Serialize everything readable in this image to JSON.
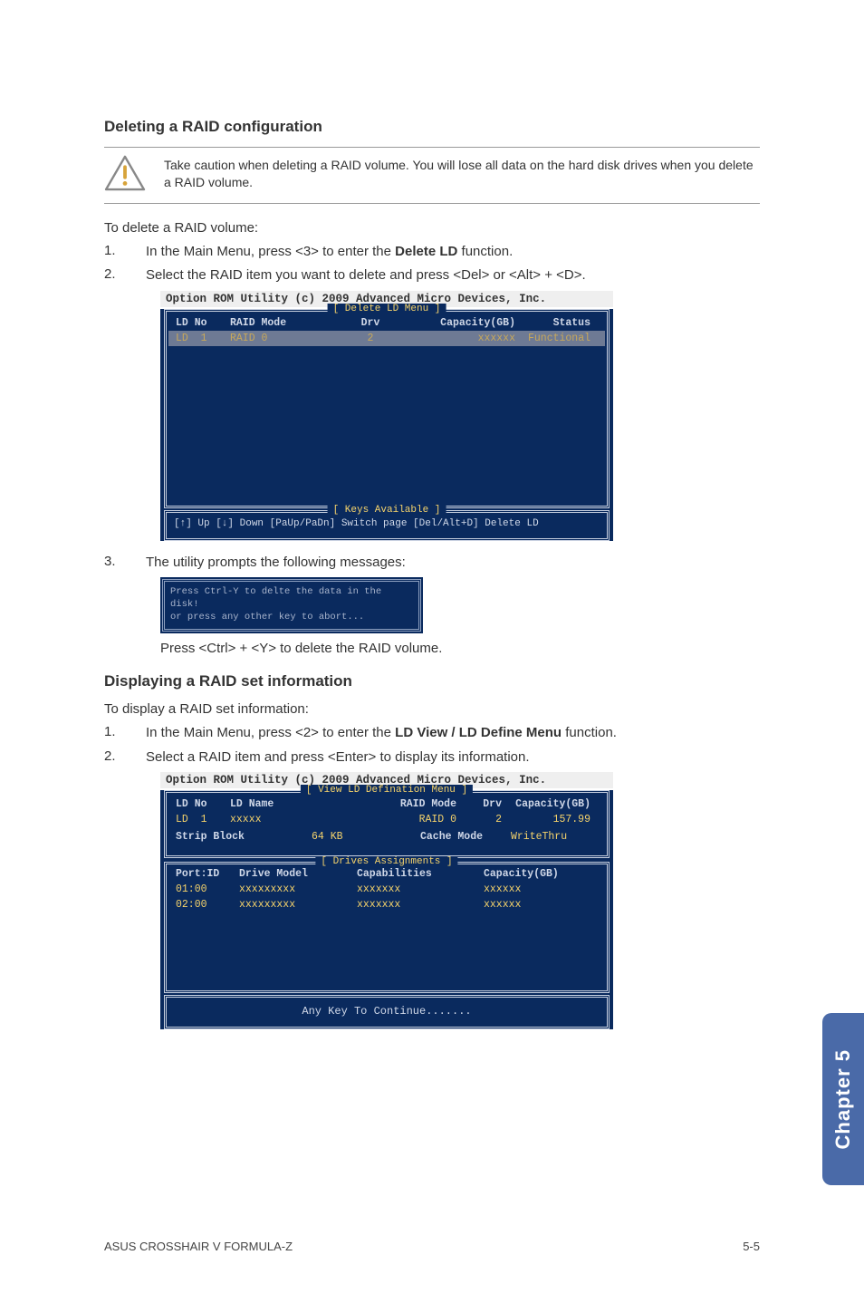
{
  "section1": {
    "heading": "Deleting a RAID configuration",
    "caution": "Take caution when deleting a RAID volume. You will lose all data on the hard disk drives when you delete a RAID volume.",
    "intro": "To delete a RAID volume:",
    "step1_pre": "In the Main Menu, press <3> to enter the ",
    "step1_strong": "Delete LD",
    "step1_post": " function.",
    "step2": "Select the RAID item you want to delete and press <Del> or <Alt> + <D>.",
    "step3": "The utility prompts the following messages:",
    "press_line": "Press <Ctrl> + <Y> to delete the RAID volume."
  },
  "bios1": {
    "caption": "Option ROM Utility (c) 2009 Advanced Micro Devices, Inc.",
    "menu_title": "[ Delete LD Menu ]",
    "cols": {
      "c1": "LD No",
      "c2": "RAID Mode",
      "c3": "Drv",
      "c4": "Capacity(GB)",
      "c5": "Status"
    },
    "row": {
      "c1": "LD  1",
      "c2": "RAID 0",
      "c3": "2",
      "c4": "xxxxxx",
      "c5": "Functional"
    },
    "keys_title": "[ Keys Available ]",
    "keys_text": "[↑] Up  [↓] Down  [PaUp/PaDn] Switch page  [Del/Alt+D] Delete LD"
  },
  "prompt": {
    "line1": "Press Ctrl-Y to delte the data in the disk!",
    "line2": "or press any other key to abort..."
  },
  "section2": {
    "heading": "Displaying a RAID set information",
    "intro": "To display a RAID set information:",
    "step1_pre": "In the Main Menu, press <2> to enter the ",
    "step1_strong": "LD View / LD Define Menu",
    "step1_post": " function.",
    "step2": "Select a RAID item and press <Enter> to display its information."
  },
  "bios2": {
    "caption": "Option ROM Utility (c) 2009 Advanced Micro Devices, Inc.",
    "menu_title": "[ View LD Defination Menu ]",
    "cols": {
      "c1": "LD No",
      "c2": "LD Name",
      "c3": "RAID Mode",
      "c4": "Drv",
      "c5": "Capacity(GB)"
    },
    "row": {
      "c1": "LD  1",
      "c2": "xxxxx",
      "c3": "RAID 0",
      "c4": "2",
      "c5": "157.99"
    },
    "strip_lbl": "Strip Block",
    "strip_val": "64 KB",
    "cache_lbl": "Cache Mode",
    "cache_val": "WriteThru",
    "drives_title": "[ Drives Assignments ]",
    "drives_cols": {
      "c1": "Port:ID",
      "c2": "Drive Model",
      "c3": "Capabilities",
      "c4": "Capacity(GB)"
    },
    "drives_rows": [
      {
        "c1": "01:00",
        "c2": "xxxxxxxxx",
        "c3": "xxxxxxx",
        "c4": "xxxxxx"
      },
      {
        "c1": "02:00",
        "c2": "xxxxxxxxx",
        "c3": "xxxxxxx",
        "c4": "xxxxxx"
      }
    ],
    "anykey": "Any Key To Continue......."
  },
  "side_tab": "Chapter 5",
  "footer_left": "ASUS CROSSHAIR V FORMULA-Z",
  "footer_right": "5-5"
}
